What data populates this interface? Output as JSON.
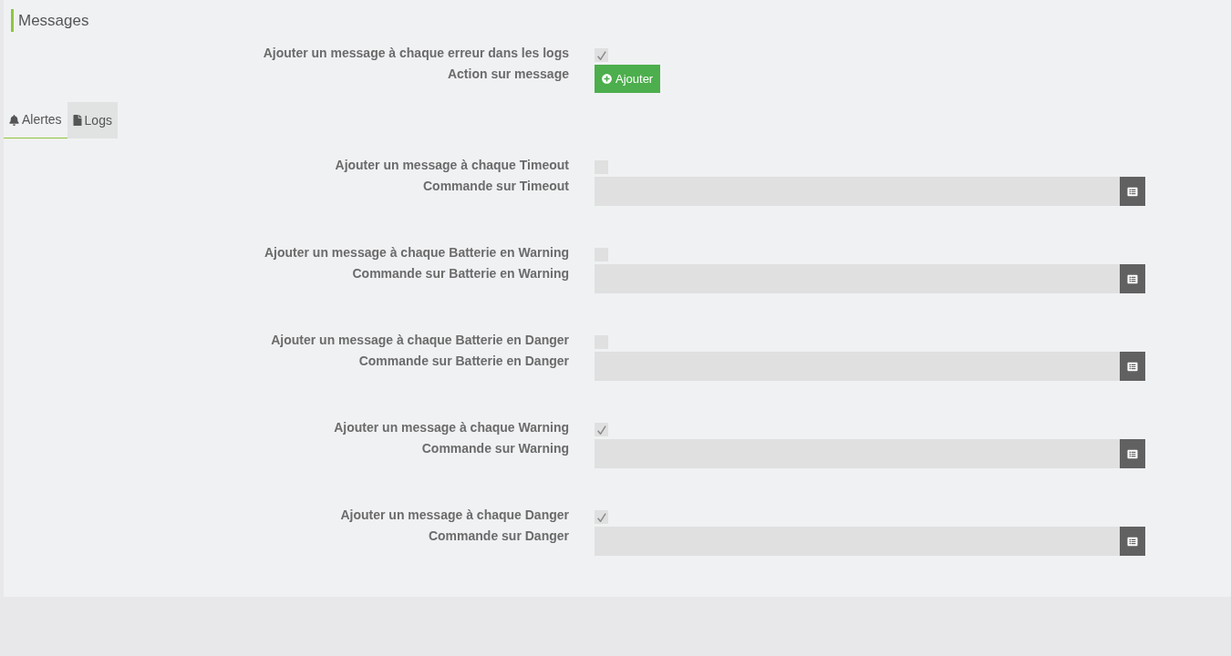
{
  "title": "Messages",
  "general": [
    {
      "kind": "checkbox",
      "label": "Ajouter un message à chaque erreur dans les logs",
      "checked": true
    },
    {
      "kind": "button",
      "label": "Action sur message",
      "button": "Ajouter"
    }
  ],
  "tabs": [
    {
      "label": "Alertes",
      "selected": true
    },
    {
      "label": "Logs",
      "selected": false
    }
  ],
  "alerts": [
    {
      "toggle_label": "Ajouter un message à chaque Timeout",
      "checked": false,
      "command_label": "Commande sur Timeout"
    },
    {
      "toggle_label": "Ajouter un message à chaque Batterie en Warning",
      "checked": false,
      "command_label": "Commande sur Batterie en Warning"
    },
    {
      "toggle_label": "Ajouter un message à chaque Batterie en Danger",
      "checked": false,
      "command_label": "Commande sur Batterie en Danger"
    },
    {
      "toggle_label": "Ajouter un message à chaque Warning",
      "checked": true,
      "command_label": "Commande sur Warning"
    },
    {
      "toggle_label": "Ajouter un message à chaque Danger",
      "checked": true,
      "command_label": "Commande sur Danger"
    }
  ]
}
